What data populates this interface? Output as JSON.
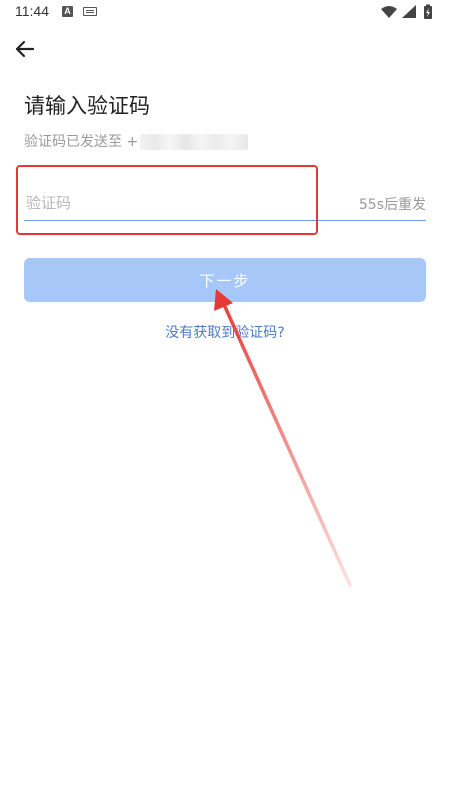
{
  "status_bar": {
    "time": "11:44",
    "notification_icon_a": "A",
    "icons": [
      "keyboard-icon",
      "wifi-icon",
      "signal-icon",
      "battery-charging-icon"
    ]
  },
  "nav": {
    "back_icon": "arrow-left-icon"
  },
  "page": {
    "title": "请输入验证码",
    "sent_to_prefix": "验证码已发送至 +"
  },
  "code_input": {
    "placeholder": "验证码",
    "value": "",
    "resend_countdown": "55s后重发"
  },
  "buttons": {
    "next_label": "下一步",
    "no_code_link": "没有获取到验证码?"
  },
  "colors": {
    "accent": "#4d7bc7",
    "button_disabled": "#a7c7f8",
    "input_underline": "#6d9de6",
    "annotation_red": "#e53935"
  }
}
